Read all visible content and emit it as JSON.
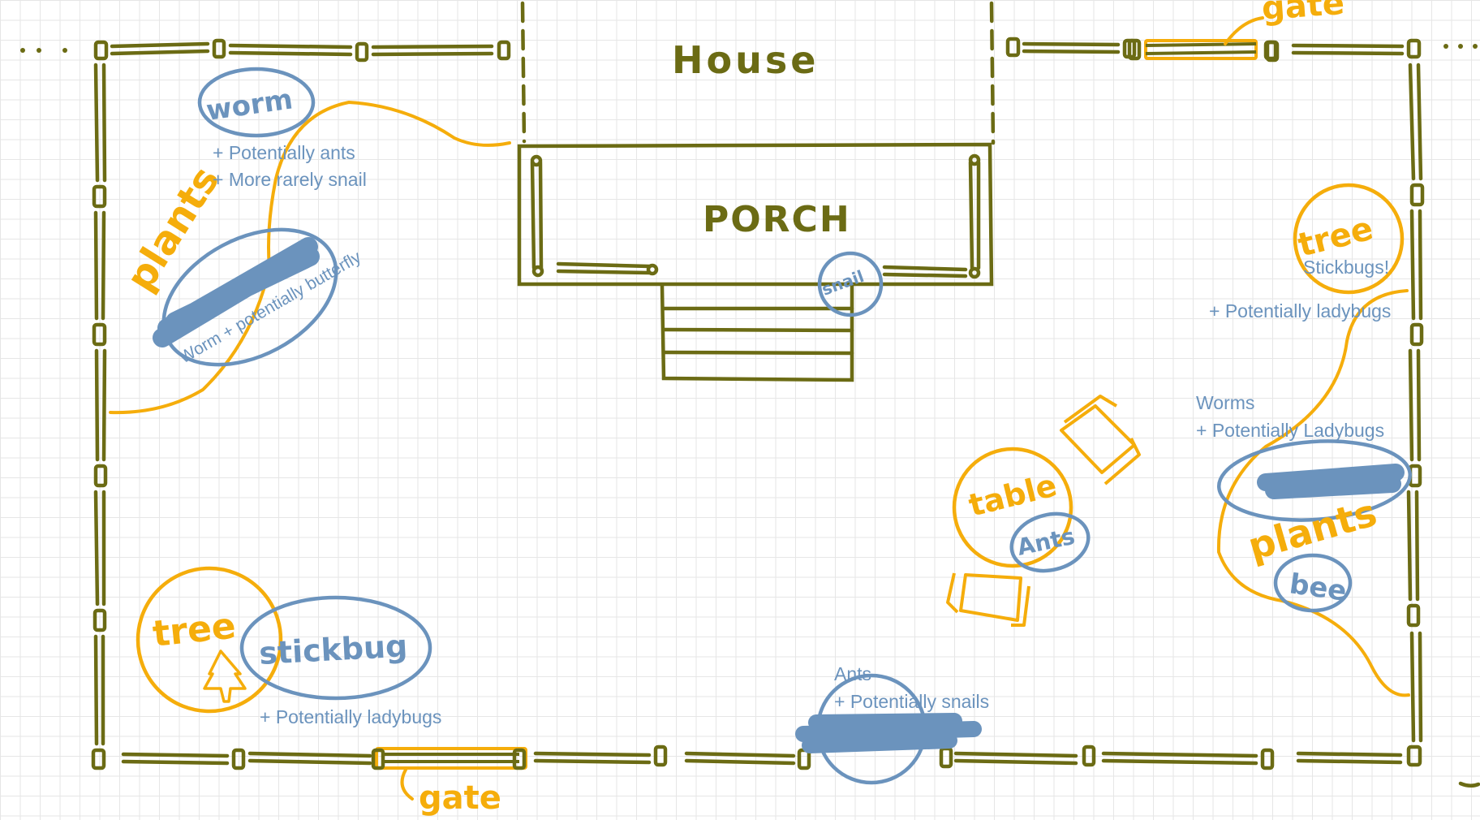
{
  "colors": {
    "fence": "#6b6b14",
    "orange": "#f5ad0b",
    "blue": "#6b93bd",
    "grid": "#e6e6e6"
  },
  "structures": {
    "house": "House",
    "porch": "PORCH",
    "gate_top": "gate",
    "gate_bottom": "gate"
  },
  "areas": {
    "plants_left": "plants",
    "plants_right": "plants",
    "tree_left": "tree",
    "tree_right": "tree",
    "table": "table"
  },
  "creatures": {
    "worm": "worm",
    "stickbug": "stickbug",
    "ants": "Ants",
    "bee": "bee",
    "snail": "snail"
  },
  "notes": {
    "worm_line1": "+ Potentially ants",
    "worm_line2": "+ More rarely snail",
    "plants_left": "Worm + potentially butterfly",
    "tree_right_line1": "Stickbugs!",
    "tree_right_line2": "+ Potentially ladybugs",
    "plants_right_line1": "Worms",
    "plants_right_line2": "+ Potentially Ladybugs",
    "stickbug": "+ Potentially ladybugs",
    "gate_bottom_line1": "Ants",
    "gate_bottom_line2": "+ Potentially snails"
  }
}
